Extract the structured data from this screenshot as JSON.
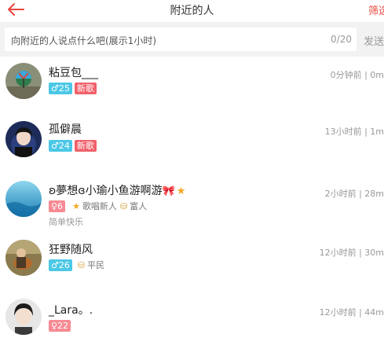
{
  "header": {
    "title": "附近的人",
    "filter_label": "筛选"
  },
  "compose": {
    "placeholder": "向附近的人说点什么吧(展示1小时)",
    "counter": "0/20",
    "send_label": "发送"
  },
  "users": [
    {
      "name": "粘豆包___",
      "time": "0分钟前 | 0m",
      "age": "♂25",
      "tags": [
        "新歌"
      ],
      "badge": "",
      "signature": ""
    },
    {
      "name": "孤僻晨",
      "time": "13小时前 | 1m",
      "age": "♂24",
      "tags": [
        "新歌"
      ],
      "badge": "",
      "signature": ""
    },
    {
      "name": "ʚ夢想ɞ小瑜小鱼游啊游",
      "time": "2小时前 | 28m",
      "age": "♀6",
      "tags": [],
      "badges": [
        "歌唱新人",
        "富人"
      ],
      "signature": "简单快乐"
    },
    {
      "name": "狂野随风",
      "time": "12小时前 | 30m",
      "age": "♂26",
      "tags": [],
      "badges": [
        "平民"
      ],
      "signature": ""
    },
    {
      "name": "_Lara。.",
      "time": "12小时前 | 44m",
      "age": "♀22",
      "tags": [],
      "badges": [],
      "signature": ""
    }
  ],
  "colors": {
    "accent": "#e8453c",
    "male": "#4bc8e6",
    "female": "#f68a94",
    "song": "#f0616a"
  }
}
